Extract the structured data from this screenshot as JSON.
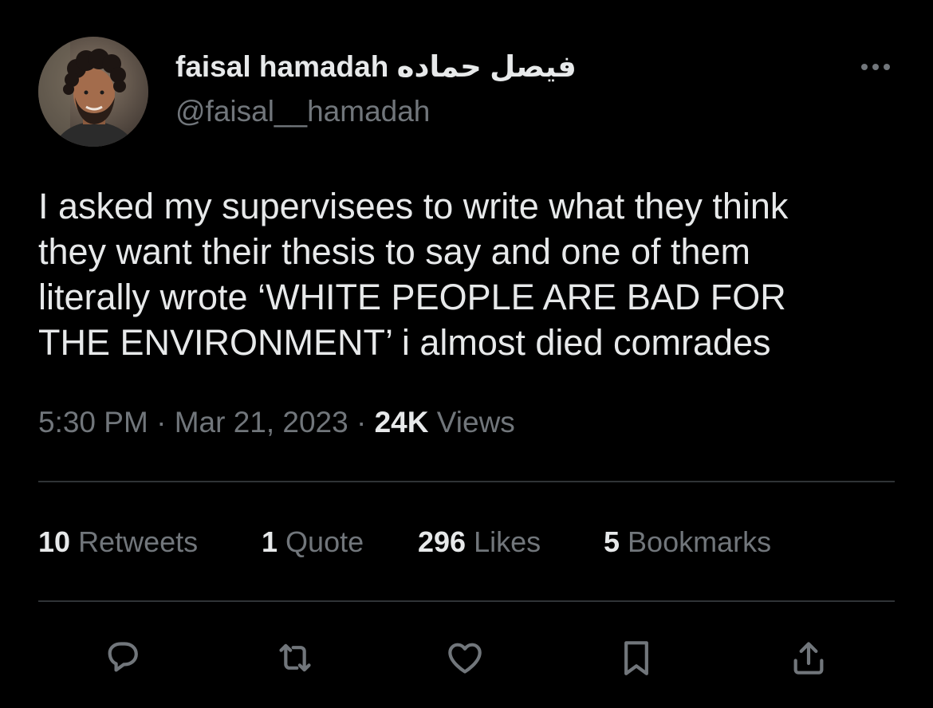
{
  "author": {
    "display_name": "faisal hamadah فيصل حماده",
    "handle": "@faisal__hamadah"
  },
  "tweet": {
    "lines": [
      "I asked my supervisees to write what they think",
      "they want their thesis to say and one of them",
      "literally wrote ‘WHITE PEOPLE ARE BAD FOR",
      "THE ENVIRONMENT’ i almost died comrades"
    ],
    "time": "5:30 PM",
    "date": "Mar 21, 2023",
    "views_count": "24K",
    "views_label": "Views",
    "separator": "·"
  },
  "stats": {
    "retweets_count": "10",
    "retweets_label": "Retweets",
    "quotes_count": "1",
    "quotes_label": "Quote",
    "likes_count": "296",
    "likes_label": "Likes",
    "bookmarks_count": "5",
    "bookmarks_label": "Bookmarks"
  },
  "icons": {
    "more": "more-horizontal-icon",
    "reply": "reply-icon",
    "retweet": "retweet-icon",
    "like": "heart-icon",
    "bookmark": "bookmark-icon",
    "share": "share-icon"
  },
  "colors": {
    "background": "#000000",
    "primary_text": "#e7e9ea",
    "secondary_text": "#71767b",
    "divider": "#2f3336"
  }
}
